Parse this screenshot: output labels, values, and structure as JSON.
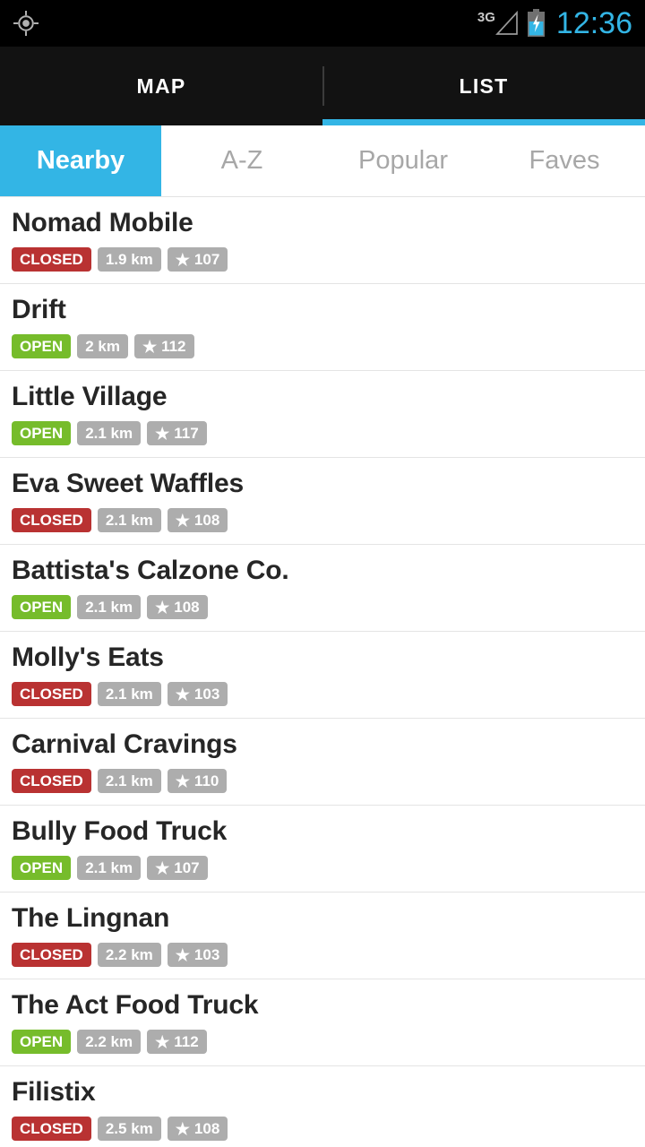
{
  "statusbar": {
    "gps_icon": "gps-location-icon",
    "network_type": "3G",
    "signal_icon": "signal-no-bars-icon",
    "battery_icon": "battery-charging-icon",
    "clock": "12:36",
    "accent_color": "#33b5e5"
  },
  "toptabs": {
    "items": [
      {
        "label": "MAP",
        "active": false
      },
      {
        "label": "LIST",
        "active": true
      }
    ],
    "active_underline_color": "#33b5e5"
  },
  "subtabs": {
    "items": [
      {
        "label": "Nearby",
        "active": true
      },
      {
        "label": "A-Z",
        "active": false
      },
      {
        "label": "Popular",
        "active": false
      },
      {
        "label": "Faves",
        "active": false
      }
    ],
    "active_background": "#33b5e5",
    "inactive_color": "#a7a7a7"
  },
  "colors": {
    "open": "#76bc2b",
    "closed": "#b93232",
    "neutral_badge": "#adadad",
    "title": "#262626"
  },
  "list": {
    "star_glyph": "★",
    "items": [
      {
        "name": "Nomad Mobile",
        "status": "CLOSED",
        "distance": "1.9 km",
        "rating": "107"
      },
      {
        "name": "Drift",
        "status": "OPEN",
        "distance": "2 km",
        "rating": "112"
      },
      {
        "name": "Little Village",
        "status": "OPEN",
        "distance": "2.1 km",
        "rating": "117"
      },
      {
        "name": "Eva Sweet Waffles",
        "status": "CLOSED",
        "distance": "2.1 km",
        "rating": "108"
      },
      {
        "name": "Battista's Calzone Co.",
        "status": "OPEN",
        "distance": "2.1 km",
        "rating": "108"
      },
      {
        "name": "Molly's Eats",
        "status": "CLOSED",
        "distance": "2.1 km",
        "rating": "103"
      },
      {
        "name": "Carnival Cravings",
        "status": "CLOSED",
        "distance": "2.1 km",
        "rating": "110"
      },
      {
        "name": "Bully Food Truck",
        "status": "OPEN",
        "distance": "2.1 km",
        "rating": "107"
      },
      {
        "name": "The Lingnan",
        "status": "CLOSED",
        "distance": "2.2 km",
        "rating": "103"
      },
      {
        "name": "The Act Food Truck",
        "status": "OPEN",
        "distance": "2.2 km",
        "rating": "112"
      },
      {
        "name": "Filistix",
        "status": "CLOSED",
        "distance": "2.5 km",
        "rating": "108"
      }
    ]
  }
}
